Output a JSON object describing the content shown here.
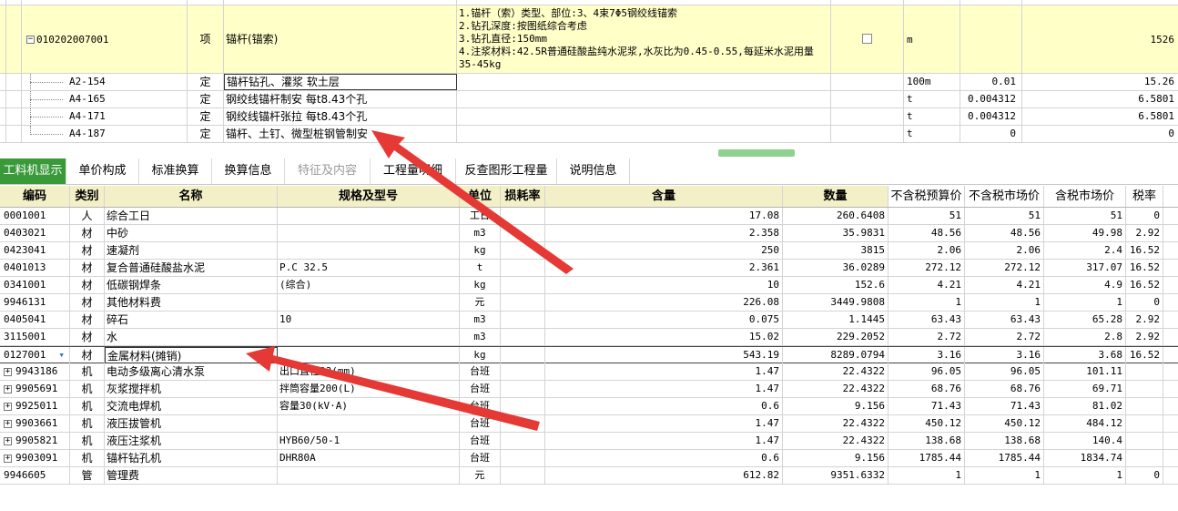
{
  "upper_grid": {
    "main_row": {
      "code": "010202007001",
      "category": "项",
      "name": "锚杆(锚索)",
      "features": [
        "1.锚杆（索）类型、部位:3、4束7Φ5钢绞线锚索",
        "2.钻孔深度:按图纸综合考虑",
        "3.钻孔直径:150mm",
        "4.注浆材料:42.5R普通硅酸盐纯水泥浆,水灰比为0.45-0.55,每延米水泥用量",
        "35-45kg"
      ],
      "unit": "m",
      "quantity": "1526"
    },
    "sub_rows": [
      {
        "code": "A2-154",
        "category": "定",
        "name": "锚杆钻孔、灌浆 软土层",
        "unit": "100m",
        "coef": "0.01",
        "quantity": "15.26"
      },
      {
        "code": "A4-165",
        "category": "定",
        "name": "钢绞线锚杆制安 每t8.43个孔",
        "unit": "t",
        "coef": "0.004312",
        "quantity": "6.5801"
      },
      {
        "code": "A4-171",
        "category": "定",
        "name": "钢绞线锚杆张拉 每t8.43个孔",
        "unit": "t",
        "coef": "0.004312",
        "quantity": "6.5801"
      },
      {
        "code": "A4-187",
        "category": "定",
        "name": "锚杆、土钉、微型桩钢管制安",
        "unit": "t",
        "coef": "0",
        "quantity": "0"
      }
    ]
  },
  "tabs": [
    {
      "label": "工料机显示",
      "state": "active"
    },
    {
      "label": "单价构成",
      "state": "normal"
    },
    {
      "label": "标准换算",
      "state": "normal"
    },
    {
      "label": "换算信息",
      "state": "normal"
    },
    {
      "label": "特征及内容",
      "state": "disabled"
    },
    {
      "label": "工程量明细",
      "state": "normal"
    },
    {
      "label": "反查图形工程量",
      "state": "normal"
    },
    {
      "label": "说明信息",
      "state": "normal"
    }
  ],
  "lower_grid": {
    "headers": {
      "code": "编码",
      "category": "类别",
      "name": "名称",
      "spec": "规格及型号",
      "unit": "单位",
      "loss": "损耗率",
      "content": "含量",
      "quantity": "数量",
      "price_excl_budget": "不含税预算价",
      "price_excl_market": "不含税市场价",
      "price_incl_market": "含税市场价",
      "tax_rate": "税率"
    },
    "rows": [
      {
        "code": "0001001",
        "category": "人",
        "name": "综合工日",
        "spec": "",
        "unit": "工日",
        "content": "17.08",
        "quantity": "260.6408",
        "p1": "51",
        "p2": "51",
        "p3": "51",
        "tax": "0",
        "expandable": false
      },
      {
        "code": "0403021",
        "category": "材",
        "name": "中砂",
        "spec": "",
        "unit": "m3",
        "content": "2.358",
        "quantity": "35.9831",
        "p1": "48.56",
        "p2": "48.56",
        "p3": "49.98",
        "tax": "2.92",
        "expandable": false
      },
      {
        "code": "0423041",
        "category": "材",
        "name": "速凝剂",
        "spec": "",
        "unit": "kg",
        "content": "250",
        "quantity": "3815",
        "p1": "2.06",
        "p2": "2.06",
        "p3": "2.4",
        "tax": "16.52",
        "expandable": false
      },
      {
        "code": "0401013",
        "category": "材",
        "name": "复合普通硅酸盐水泥",
        "spec": "P.C 32.5",
        "unit": "t",
        "content": "2.361",
        "quantity": "36.0289",
        "p1": "272.12",
        "p2": "272.12",
        "p3": "317.07",
        "tax": "16.52",
        "expandable": false
      },
      {
        "code": "0341001",
        "category": "材",
        "name": "低碳钢焊条",
        "spec": "(综合)",
        "unit": "kg",
        "content": "10",
        "quantity": "152.6",
        "p1": "4.21",
        "p2": "4.21",
        "p3": "4.9",
        "tax": "16.52",
        "expandable": false
      },
      {
        "code": "9946131",
        "category": "材",
        "name": "其他材料费",
        "spec": "",
        "unit": "元",
        "content": "226.08",
        "quantity": "3449.9808",
        "p1": "1",
        "p2": "1",
        "p3": "1",
        "tax": "0",
        "expandable": false
      },
      {
        "code": "0405041",
        "category": "材",
        "name": "碎石",
        "spec": "10",
        "unit": "m3",
        "content": "0.075",
        "quantity": "1.1445",
        "p1": "63.43",
        "p2": "63.43",
        "p3": "65.28",
        "tax": "2.92",
        "expandable": false
      },
      {
        "code": "3115001",
        "category": "材",
        "name": "水",
        "spec": "",
        "unit": "m3",
        "content": "15.02",
        "quantity": "229.2052",
        "p1": "2.72",
        "p2": "2.72",
        "p3": "2.8",
        "tax": "2.92",
        "expandable": false
      },
      {
        "code": "0127001",
        "category": "材",
        "name": "金属材料(摊销)",
        "spec": "",
        "unit": "kg",
        "content": "543.19",
        "quantity": "8289.0794",
        "p1": "3.16",
        "p2": "3.16",
        "p3": "3.68",
        "tax": "16.52",
        "expandable": false,
        "selected": true
      },
      {
        "code": "9943186",
        "category": "机",
        "name": "电动多级离心清水泵",
        "spec": "出口直径??(mm)",
        "unit": "台班",
        "content": "1.47",
        "quantity": "22.4322",
        "p1": "96.05",
        "p2": "96.05",
        "p3": "101.11",
        "tax": "",
        "expandable": true
      },
      {
        "code": "9905691",
        "category": "机",
        "name": "灰浆搅拌机",
        "spec": "拌筒容量200(L)",
        "unit": "台班",
        "content": "1.47",
        "quantity": "22.4322",
        "p1": "68.76",
        "p2": "68.76",
        "p3": "69.71",
        "tax": "",
        "expandable": true
      },
      {
        "code": "9925011",
        "category": "机",
        "name": "交流电焊机",
        "spec": "容量30(kV·A)",
        "unit": "台班",
        "content": "0.6",
        "quantity": "9.156",
        "p1": "71.43",
        "p2": "71.43",
        "p3": "81.02",
        "tax": "",
        "expandable": true
      },
      {
        "code": "9903661",
        "category": "机",
        "name": "液压拔管机",
        "spec": "",
        "unit": "台班",
        "content": "1.47",
        "quantity": "22.4322",
        "p1": "450.12",
        "p2": "450.12",
        "p3": "484.12",
        "tax": "",
        "expandable": true
      },
      {
        "code": "9905821",
        "category": "机",
        "name": "液压注浆机",
        "spec": "HYB60/50-1",
        "unit": "台班",
        "content": "1.47",
        "quantity": "22.4322",
        "p1": "138.68",
        "p2": "138.68",
        "p3": "140.4",
        "tax": "",
        "expandable": true
      },
      {
        "code": "9903091",
        "category": "机",
        "name": "锚杆钻孔机",
        "spec": "DHR80A",
        "unit": "台班",
        "content": "0.6",
        "quantity": "9.156",
        "p1": "1785.44",
        "p2": "1785.44",
        "p3": "1834.74",
        "tax": "",
        "expandable": true
      },
      {
        "code": "9946605",
        "category": "管",
        "name": "管理费",
        "spec": "",
        "unit": "元",
        "content": "612.82",
        "quantity": "9351.6332",
        "p1": "1",
        "p2": "1",
        "p3": "1",
        "tax": "0",
        "expandable": false
      }
    ]
  },
  "colors": {
    "main_row_bg": "#ffffc8",
    "tab_active_bg": "#3a9a3a",
    "header_bg": "#f3f0c8",
    "arrow_red": "#e53935"
  },
  "icons": {
    "collapse": "minus-box-icon",
    "expand": "plus-box-icon",
    "dropdown": "dropdown-triangle-icon",
    "annotation": "red-arrow-annotation"
  }
}
